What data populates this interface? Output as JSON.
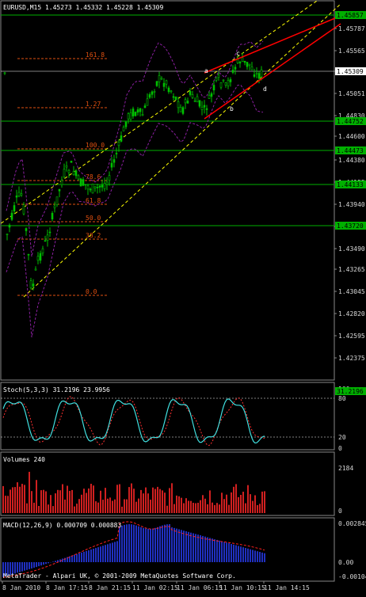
{
  "window_title": "EURUSD,M15  1.45273 1.45332 1.45228 1.45309",
  "watermark": "MetaTrader - Alpari UK, © 2001-2009 MetaQuotes Software Corp.",
  "main_axis": {
    "labels": [
      "1.45787",
      "1.45565",
      "1.45309",
      "1.45051",
      "1.44830",
      "1.44600",
      "1.44380",
      "1.44155",
      "1.43940",
      "1.43720",
      "1.43490",
      "1.43265",
      "1.43045",
      "1.42820",
      "1.42595",
      "1.42375"
    ],
    "boxes": [
      {
        "label": "1.45857",
        "color": "#00b000"
      },
      {
        "label": "1.45309",
        "color": "#ffffff"
      },
      {
        "label": "1.44752",
        "color": "#00b000"
      },
      {
        "label": "1.44473",
        "color": "#00b000"
      },
      {
        "label": "1.44133",
        "color": "#00b000"
      },
      {
        "label": "1.43720",
        "color": "#00b000"
      }
    ]
  },
  "fibo_levels": [
    "161.8",
    "1.27",
    "100.0",
    "78.6",
    "61.8",
    "50.0",
    "38.2",
    "0.0"
  ],
  "wave_labels": [
    "a",
    "b",
    "c",
    "d"
  ],
  "stoch": {
    "title": "Stoch(5,3,3) 31.2196 23.9956",
    "axis_labels": [
      "100",
      "80",
      "20",
      "0"
    ],
    "value_box": "31.2196"
  },
  "volumes": {
    "title": "Volumes 240",
    "axis_labels": [
      "2184",
      "0"
    ]
  },
  "macd": {
    "title": "MACD(12,26,9) 0.000709 0.000883",
    "axis_labels": [
      "0.002845",
      "0.00",
      "-0.001045"
    ]
  },
  "time_axis": [
    "8 Jan 2010",
    "8 Jan 17:15",
    "8 Jan 21:15",
    "11 Jan 02:15",
    "11 Jan 06:15",
    "11 Jan 10:15",
    "11 Jan 14:15"
  ],
  "colors": {
    "bull": "#00c000",
    "bear": "#00c000",
    "hline": "#00b000",
    "fib": "#e05010",
    "channel": "#ffff00",
    "trend": "#ff0000",
    "bands": "#8a1fa0",
    "stoch_main": "#40e0e0",
    "stoch_sig": "#ff3030",
    "vol": "#d02020",
    "macd_hist": "#2030c0",
    "macd_sig": "#ff2020"
  }
}
